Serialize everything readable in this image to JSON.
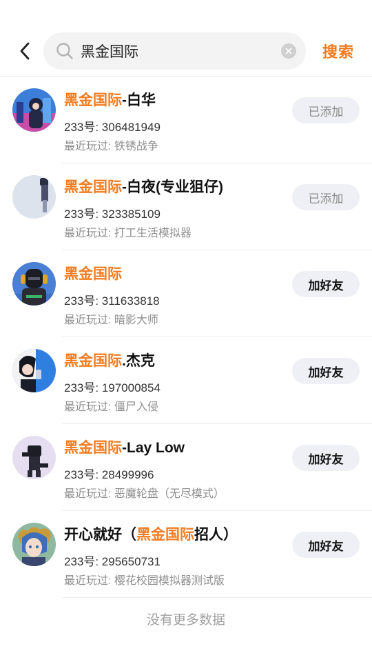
{
  "header": {
    "search_value": "黑金国际",
    "search_button": "搜索"
  },
  "results": [
    {
      "name_pre": "",
      "name_highlight": "黑金国际",
      "name_post": "-白华",
      "uid": "233号: 306481949",
      "recent": "最近玩过: 铁锈战争",
      "action": "已添加",
      "action_state": "added"
    },
    {
      "name_pre": "",
      "name_highlight": "黑金国际",
      "name_post": "-白夜(专业狙仔)",
      "uid": "233号: 323385109",
      "recent": "最近玩过: 打工生活模拟器",
      "action": "已添加",
      "action_state": "added"
    },
    {
      "name_pre": "",
      "name_highlight": "黑金国际",
      "name_post": "",
      "uid": "233号: 311633818",
      "recent": "最近玩过: 暗影大师",
      "action": "加好友",
      "action_state": "add"
    },
    {
      "name_pre": "",
      "name_highlight": "黑金国际",
      "name_post": ".杰克",
      "uid": "233号: 197000854",
      "recent": "最近玩过: 僵尸入侵",
      "action": "加好友",
      "action_state": "add"
    },
    {
      "name_pre": "",
      "name_highlight": "黑金国际",
      "name_post": "-Lay Low",
      "uid": "233号: 28499996",
      "recent": "最近玩过: 恶魔轮盘（无尽模式）",
      "action": "加好友",
      "action_state": "add"
    },
    {
      "name_pre": "开心就好（",
      "name_highlight": "黑金国际",
      "name_post": "招人）",
      "uid": "233号: 295650731",
      "recent": "最近玩过: 樱花校园模拟器测试版",
      "action": "加好友",
      "action_state": "add"
    }
  ],
  "footer": "没有更多数据",
  "colors": {
    "accent": "#f47c20",
    "button_bg": "#eef0f5"
  }
}
